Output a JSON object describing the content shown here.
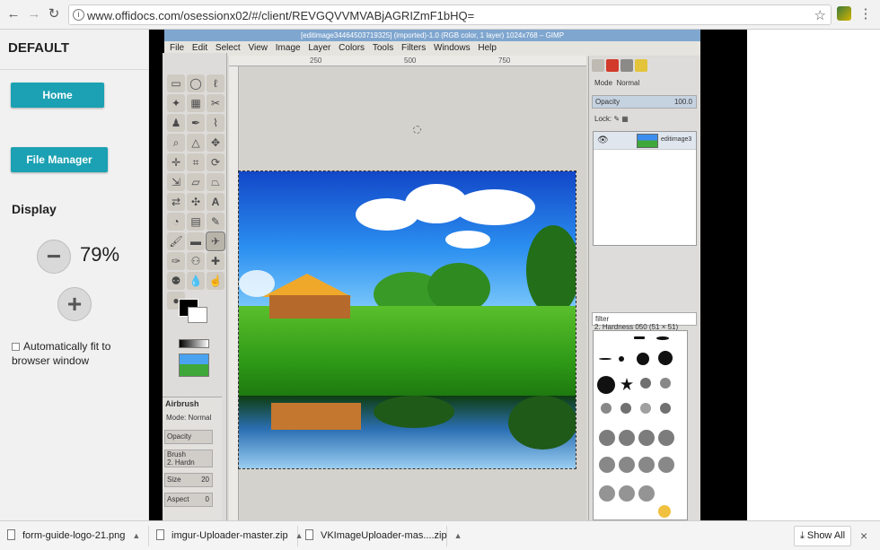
{
  "browser": {
    "url": "www.offidocs.com/osessionx02/#/client/REVGQVVMVABjAGRIZmF1bHQ=",
    "back_icon": "←",
    "forward_icon": "→",
    "reload_icon": "↻",
    "info_icon": "i",
    "star_icon": "☆",
    "menu_icon": "⋮"
  },
  "sidebar": {
    "title": "DEFAULT",
    "home_label": "Home",
    "file_manager_label": "File Manager",
    "display_label": "Display",
    "zoom_value": "79%",
    "zoom_out_glyph": "−",
    "zoom_in_glyph": "+",
    "fit_label": "Automatically fit to browser window"
  },
  "gimp": {
    "title": "[editimage34464503719325] (imported)-1.0 (RGB color, 1 layer) 1024x768 – GIMP",
    "menu": [
      "File",
      "Edit",
      "Select",
      "View",
      "Image",
      "Layer",
      "Colors",
      "Tools",
      "Filters",
      "Windows",
      "Help"
    ],
    "ruler_ticks": [
      "250",
      "500",
      "750"
    ],
    "tool_options": {
      "title": "Airbrush",
      "mode_label": "Mode:",
      "mode_value": "Normal",
      "opacity_label": "Opacity",
      "brush_label": "Brush",
      "brush_value": "2. Hardn",
      "size_label": "Size",
      "size_value": "20",
      "aspect_label": "Aspect",
      "aspect_value": "0"
    },
    "layers": {
      "mode_label": "Mode",
      "mode_value": "Normal",
      "opacity_label": "Opacity",
      "opacity_value": "100.0",
      "lock_label": "Lock:",
      "layer_name": "editimage3"
    },
    "brushes": {
      "filter_placeholder": "filter",
      "current_brush": "2. Hardness 050 (51 × 51)"
    }
  },
  "downloads": {
    "items": [
      "form-guide-logo-21.png",
      "imgur-Uploader-master.zip",
      "VKImageUploader-mas....zip"
    ],
    "show_all": "Show All",
    "close_glyph": "×"
  }
}
